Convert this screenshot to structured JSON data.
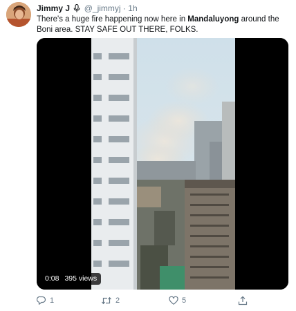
{
  "tweet": {
    "author": {
      "name": "Jimmy J",
      "handle": "@_jimmyj",
      "separator": "·",
      "time": "1h"
    },
    "text": {
      "part1": "There's a huge fire happening now here in ",
      "place": "Mandaluyong",
      "part2": " around the Boni area. STAY SAFE OUT THERE, FOLKS."
    },
    "video": {
      "elapsed": "0:08",
      "views": "395 views"
    },
    "actions": {
      "reply_count": "1",
      "retweet_count": "2",
      "like_count": "5"
    }
  },
  "colors": {
    "text": "#14171a",
    "muted": "#657786",
    "video_bg": "#000000"
  },
  "icons": [
    "avatar",
    "microphone-icon",
    "reply-icon",
    "retweet-icon",
    "like-icon",
    "share-icon"
  ]
}
